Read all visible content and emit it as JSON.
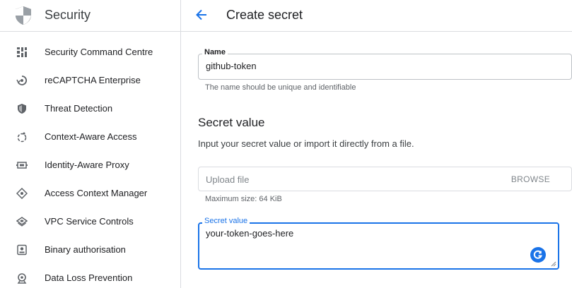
{
  "sidebar": {
    "title": "Security",
    "items": [
      {
        "label": "Security Command Centre",
        "icon": "dashboard-grid-icon"
      },
      {
        "label": "reCAPTCHA Enterprise",
        "icon": "recaptcha-icon"
      },
      {
        "label": "Threat Detection",
        "icon": "shield-icon"
      },
      {
        "label": "Context-Aware Access",
        "icon": "context-access-icon"
      },
      {
        "label": "Identity-Aware Proxy",
        "icon": "proxy-icon"
      },
      {
        "label": "Access Context Manager",
        "icon": "diamond-nodes-icon"
      },
      {
        "label": "VPC Service Controls",
        "icon": "layers-icon"
      },
      {
        "label": "Binary authorisation",
        "icon": "binary-auth-icon"
      },
      {
        "label": "Data Loss Prevention",
        "icon": "search-shield-icon"
      }
    ]
  },
  "header": {
    "title": "Create secret"
  },
  "form": {
    "name_label": "Name",
    "name_value": "github-token",
    "name_hint": "The name should be unique and identifiable",
    "section_title": "Secret value",
    "section_desc": "Input your secret value or import it directly from a file.",
    "upload_placeholder": "Upload file",
    "browse_label": "BROWSE",
    "upload_hint": "Maximum size: 64 KiB",
    "secret_label": "Secret value",
    "secret_value": "your-token-goes-here"
  },
  "colors": {
    "accent": "#1a73e8",
    "border": "#dadce0",
    "icon": "#5f6368"
  }
}
